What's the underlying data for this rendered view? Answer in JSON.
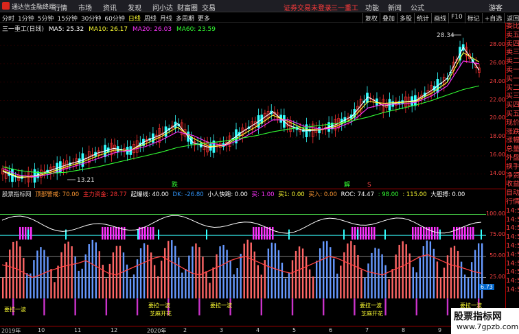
{
  "app": {
    "title": "通达信金融终端",
    "menu": [
      "行情",
      "市场",
      "资讯",
      "发现",
      "问小达",
      "财富圈",
      "交易"
    ],
    "status_link": "证券交易未登录",
    "stock_name": "三一重工",
    "top_right": [
      "功能",
      "新闻",
      "公式"
    ],
    "guest": "游客"
  },
  "periodbar": {
    "periods": [
      "分时",
      "1分钟",
      "5分钟",
      "15分钟",
      "30分钟",
      "60分钟",
      "日线",
      "周线",
      "月线",
      "多周期",
      "更多"
    ],
    "active": "日线",
    "tools": [
      "复权",
      "叠加",
      "多股",
      "统计",
      "画线",
      "F10",
      "标记",
      "+自选",
      "返回"
    ]
  },
  "main_indicator": {
    "name": "三一重工(日线)",
    "ma5": "MA5: 25.32",
    "ma10": "MA10: 26.17",
    "ma20": "MA20: 26.03",
    "ma60": "MA60: 23.59",
    "colors": {
      "ma5": "#ffffff",
      "ma10": "#ffff33",
      "ma20": "#ff33ff",
      "ma60": "#33ff33"
    }
  },
  "chart_annotations": {
    "high": "28.34",
    "low": "13.21",
    "mark_die": "跌",
    "mark_jie": "解",
    "mark_s": "S"
  },
  "sub_indicator": {
    "name": "股票指标网",
    "f1": "顶部警戒: 70.00",
    "f2": "主力资金: 28.77",
    "f3": "起爆线: 40.00",
    "f4": "DK: -26.80",
    "f5": "小人快跑: 0.00",
    "f6": "买: 1.00",
    "f7": "买1: 0.00",
    "f8": "买入: 0.00",
    "f9": "ROC: 74.47",
    "f10": ": 98.00",
    "f11": ": 115.00",
    "f12": "大胆搏: 0.00",
    "value_badge": "6.73",
    "signal_labels": [
      "要拉一波",
      "要拉一波",
      "要拉一波",
      "要拉一波",
      "要拉一波"
    ],
    "flower_labels": [
      "芝麻开花",
      "芝麻开花"
    ]
  },
  "chart_data": [
    {
      "type": "line",
      "title": "三一重工(日线)",
      "ylim": [
        12.5,
        29.5
      ],
      "y_ticks": [
        "28.00",
        "26.00",
        "24.00",
        "22.00",
        "20.00",
        "18.00",
        "16.00",
        "14.00"
      ],
      "y_tick_values": [
        28,
        26,
        24,
        22,
        20,
        18,
        16,
        14
      ],
      "x_labels": [
        "2019年",
        "10",
        "11",
        "12",
        "2020年",
        "2",
        "3",
        "4",
        "5",
        "6",
        "7",
        "8",
        "9"
      ],
      "series": [
        {
          "name": "MA5",
          "color": "#ffffff",
          "values": [
            14.3,
            13.6,
            13.8,
            14.4,
            15.0,
            15.5,
            16.3,
            16.8,
            16.5,
            17.6,
            18.3,
            19.5,
            17.4,
            16.9,
            17.2,
            18.5,
            19.6,
            20.8,
            19.3,
            18.7,
            18.8,
            19.4,
            20.3,
            22.4,
            21.4,
            21.8,
            22.0,
            23.1,
            24.4,
            27.8,
            25.3
          ]
        },
        {
          "name": "MA10",
          "color": "#ffff33",
          "values": [
            14.4,
            13.7,
            13.7,
            14.2,
            14.8,
            15.3,
            16.0,
            16.6,
            16.6,
            17.3,
            18.1,
            19.1,
            17.9,
            17.0,
            17.1,
            18.2,
            19.2,
            20.4,
            19.7,
            18.9,
            18.8,
            19.2,
            20.0,
            21.9,
            21.7,
            21.8,
            21.9,
            22.8,
            24.0,
            27.2,
            26.2
          ]
        },
        {
          "name": "MA20",
          "color": "#ff33ff",
          "values": [
            14.6,
            13.9,
            13.7,
            14.0,
            14.6,
            15.1,
            15.7,
            16.3,
            16.6,
            17.0,
            17.7,
            18.6,
            18.2,
            17.4,
            17.1,
            17.8,
            18.8,
            19.9,
            19.9,
            19.2,
            18.9,
            19.0,
            19.7,
            21.2,
            21.6,
            21.6,
            21.8,
            22.5,
            23.6,
            26.3,
            26.0
          ]
        },
        {
          "name": "MA60",
          "color": "#33ff33",
          "values": [
            14.8,
            14.4,
            14.2,
            14.1,
            14.2,
            14.5,
            14.8,
            15.2,
            15.6,
            16.0,
            16.4,
            16.9,
            17.2,
            17.4,
            17.6,
            17.9,
            18.2,
            18.6,
            18.9,
            19.1,
            19.3,
            19.5,
            19.8,
            20.2,
            20.7,
            21.1,
            21.5,
            22.0,
            22.6,
            23.2,
            23.6
          ]
        }
      ]
    },
    {
      "type": "bar",
      "title": "股票指标网",
      "ylim": [
        -30,
        120
      ],
      "y_ticks": [
        "100.00",
        "75.00",
        "50.00",
        "25.00"
      ],
      "y_tick_values": [
        100,
        75,
        50,
        25
      ],
      "series": [
        {
          "name": "主力资金",
          "color": "#ff4444",
          "values": [
            40,
            38,
            35,
            30,
            25,
            28,
            32,
            35,
            38,
            40,
            42,
            45,
            40,
            35,
            30,
            28,
            32,
            36,
            40,
            44,
            48,
            50,
            45,
            40,
            35,
            30,
            28,
            32,
            36,
            40,
            45,
            48,
            50,
            46,
            42,
            38,
            35,
            32,
            30,
            34,
            38,
            42,
            46,
            50,
            48,
            44,
            40,
            36,
            32,
            30,
            28,
            32,
            36,
            40,
            45,
            50,
            52,
            48,
            44,
            40,
            38,
            35,
            32,
            30
          ]
        }
      ]
    }
  ]
}
